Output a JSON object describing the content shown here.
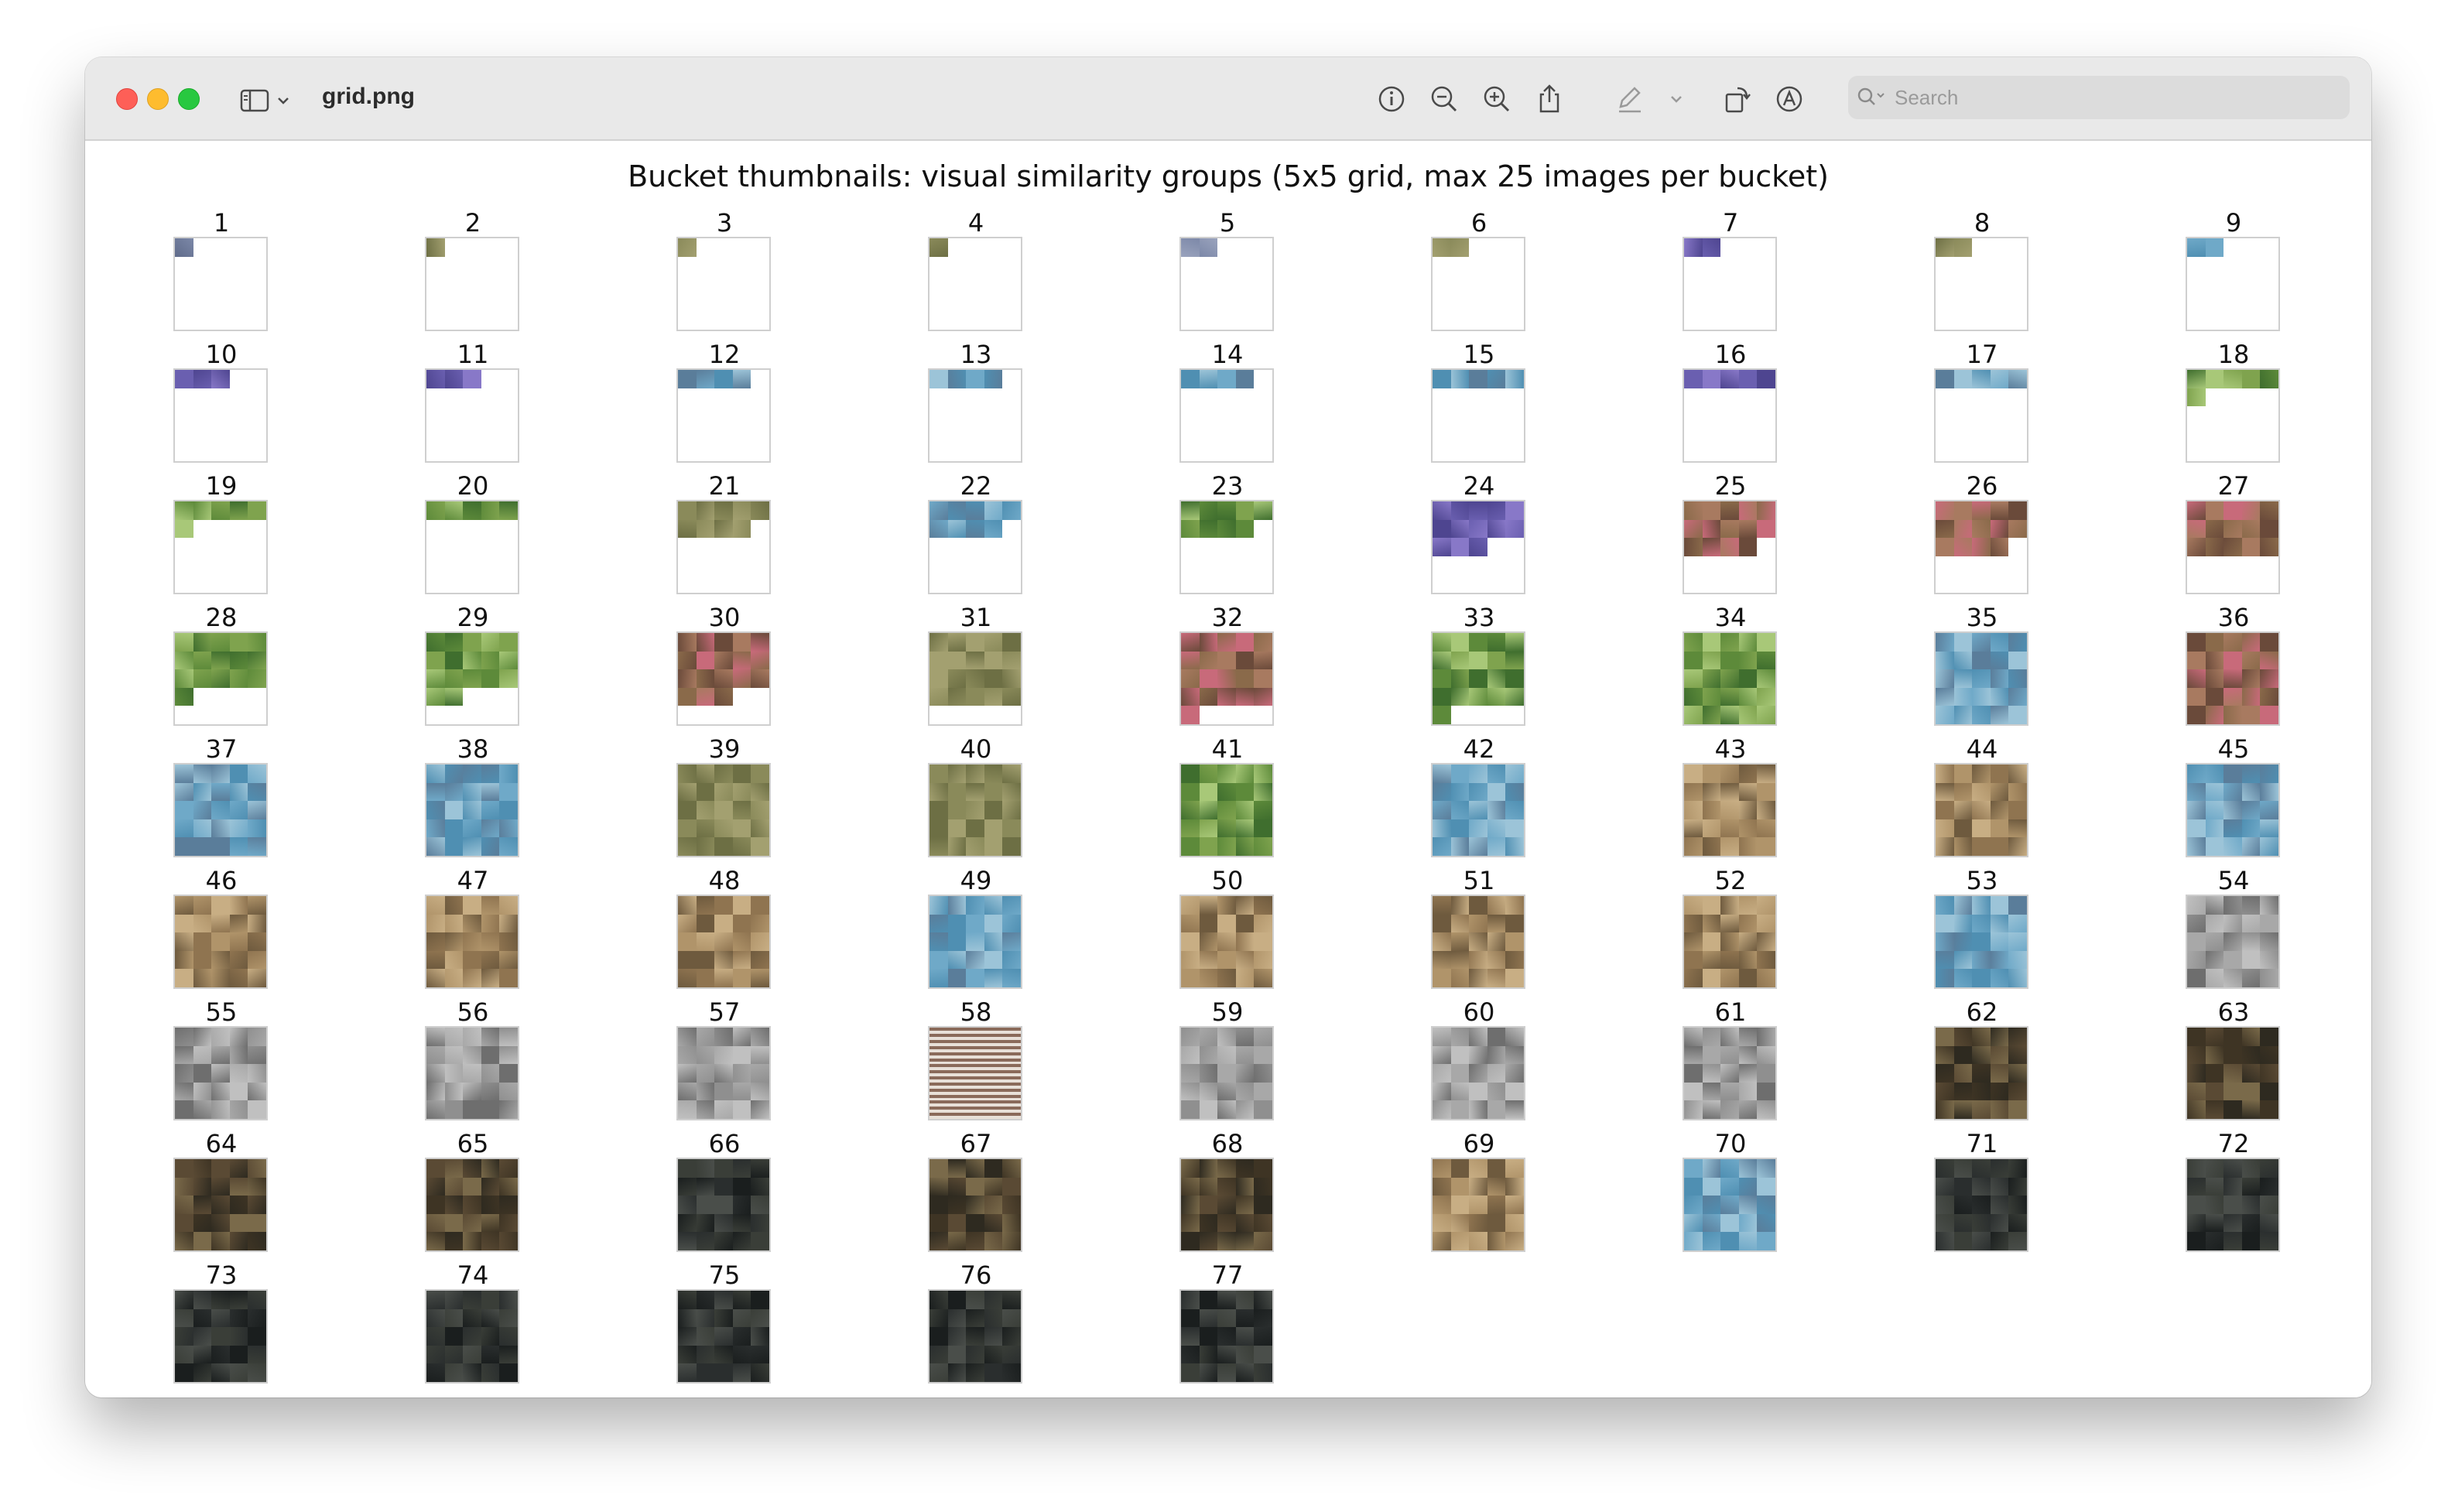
{
  "window": {
    "title": "grid.png"
  },
  "toolbar": {
    "search_placeholder": "Search",
    "icons": [
      "info-icon",
      "zoom-out-icon",
      "zoom-in-icon",
      "share-icon",
      "markup-pen-icon",
      "chevron-down-icon",
      "rotate-icon",
      "annotate-icon"
    ]
  },
  "figure": {
    "title": "Bucket thumbnails: visual similarity groups (5x5 grid, max 25 images per bucket)",
    "buckets": [
      {
        "label": "1",
        "fill": 1,
        "palette": "slate"
      },
      {
        "label": "2",
        "fill": 1,
        "palette": "olive"
      },
      {
        "label": "3",
        "fill": 1,
        "palette": "olive"
      },
      {
        "label": "4",
        "fill": 1,
        "palette": "olive"
      },
      {
        "label": "5",
        "fill": 2,
        "palette": "slate"
      },
      {
        "label": "6",
        "fill": 2,
        "palette": "olive"
      },
      {
        "label": "7",
        "fill": 2,
        "palette": "purple"
      },
      {
        "label": "8",
        "fill": 2,
        "palette": "olive"
      },
      {
        "label": "9",
        "fill": 2,
        "palette": "sky"
      },
      {
        "label": "10",
        "fill": 3,
        "palette": "purple"
      },
      {
        "label": "11",
        "fill": 3,
        "palette": "purple"
      },
      {
        "label": "12",
        "fill": 4,
        "palette": "sky"
      },
      {
        "label": "13",
        "fill": 4,
        "palette": "sky"
      },
      {
        "label": "14",
        "fill": 4,
        "palette": "sky"
      },
      {
        "label": "15",
        "fill": 5,
        "palette": "sky"
      },
      {
        "label": "16",
        "fill": 5,
        "palette": "purple"
      },
      {
        "label": "17",
        "fill": 5,
        "palette": "sky"
      },
      {
        "label": "18",
        "fill": 6,
        "palette": "green"
      },
      {
        "label": "19",
        "fill": 6,
        "palette": "green"
      },
      {
        "label": "20",
        "fill": 5,
        "palette": "green"
      },
      {
        "label": "21",
        "fill": 9,
        "palette": "olive"
      },
      {
        "label": "22",
        "fill": 9,
        "palette": "sky"
      },
      {
        "label": "23",
        "fill": 9,
        "palette": "green"
      },
      {
        "label": "24",
        "fill": 13,
        "palette": "purple"
      },
      {
        "label": "25",
        "fill": 14,
        "palette": "pink"
      },
      {
        "label": "26",
        "fill": 14,
        "palette": "pink"
      },
      {
        "label": "27",
        "fill": 15,
        "palette": "pink"
      },
      {
        "label": "28",
        "fill": 16,
        "palette": "green"
      },
      {
        "label": "29",
        "fill": 17,
        "palette": "green"
      },
      {
        "label": "30",
        "fill": 18,
        "palette": "pink"
      },
      {
        "label": "31",
        "fill": 20,
        "palette": "olive"
      },
      {
        "label": "32",
        "fill": 21,
        "palette": "pink"
      },
      {
        "label": "33",
        "fill": 21,
        "palette": "green"
      },
      {
        "label": "34",
        "fill": 25,
        "palette": "green"
      },
      {
        "label": "35",
        "fill": 25,
        "palette": "sky"
      },
      {
        "label": "36",
        "fill": 25,
        "palette": "pink"
      },
      {
        "label": "37",
        "fill": 25,
        "palette": "sky"
      },
      {
        "label": "38",
        "fill": 25,
        "palette": "sky"
      },
      {
        "label": "39",
        "fill": 25,
        "palette": "olive"
      },
      {
        "label": "40",
        "fill": 25,
        "palette": "olive"
      },
      {
        "label": "41",
        "fill": 25,
        "palette": "green"
      },
      {
        "label": "42",
        "fill": 25,
        "palette": "sky"
      },
      {
        "label": "43",
        "fill": 25,
        "palette": "tan"
      },
      {
        "label": "44",
        "fill": 25,
        "palette": "tan"
      },
      {
        "label": "45",
        "fill": 25,
        "palette": "sky"
      },
      {
        "label": "46",
        "fill": 25,
        "palette": "tan"
      },
      {
        "label": "47",
        "fill": 25,
        "palette": "tan"
      },
      {
        "label": "48",
        "fill": 25,
        "palette": "tan"
      },
      {
        "label": "49",
        "fill": 25,
        "palette": "sky"
      },
      {
        "label": "50",
        "fill": 25,
        "palette": "tan"
      },
      {
        "label": "51",
        "fill": 25,
        "palette": "tan"
      },
      {
        "label": "52",
        "fill": 25,
        "palette": "tan"
      },
      {
        "label": "53",
        "fill": 25,
        "palette": "sky"
      },
      {
        "label": "54",
        "fill": 25,
        "palette": "grey"
      },
      {
        "label": "55",
        "fill": 25,
        "palette": "grey"
      },
      {
        "label": "56",
        "fill": 25,
        "palette": "grey"
      },
      {
        "label": "57",
        "fill": 25,
        "palette": "grey"
      },
      {
        "label": "58",
        "fill": 25,
        "palette": "stripe"
      },
      {
        "label": "59",
        "fill": 25,
        "palette": "grey"
      },
      {
        "label": "60",
        "fill": 25,
        "palette": "grey"
      },
      {
        "label": "61",
        "fill": 25,
        "palette": "grey"
      },
      {
        "label": "62",
        "fill": 25,
        "palette": "dark"
      },
      {
        "label": "63",
        "fill": 25,
        "palette": "dark"
      },
      {
        "label": "64",
        "fill": 25,
        "palette": "dark"
      },
      {
        "label": "65",
        "fill": 25,
        "palette": "dark"
      },
      {
        "label": "66",
        "fill": 25,
        "palette": "night"
      },
      {
        "label": "67",
        "fill": 25,
        "palette": "dark"
      },
      {
        "label": "68",
        "fill": 25,
        "palette": "dark"
      },
      {
        "label": "69",
        "fill": 25,
        "palette": "tan"
      },
      {
        "label": "70",
        "fill": 25,
        "palette": "sky"
      },
      {
        "label": "71",
        "fill": 25,
        "palette": "night"
      },
      {
        "label": "72",
        "fill": 25,
        "palette": "night"
      },
      {
        "label": "73",
        "fill": 25,
        "palette": "night"
      },
      {
        "label": "74",
        "fill": 25,
        "palette": "night"
      },
      {
        "label": "75",
        "fill": 25,
        "palette": "night"
      },
      {
        "label": "76",
        "fill": 25,
        "palette": "night"
      },
      {
        "label": "77",
        "fill": 25,
        "palette": "night"
      }
    ]
  },
  "colors": {
    "close": "#fe5f57",
    "minimize": "#febc2e",
    "maximize": "#28c840",
    "palettes": {
      "slate": [
        "#7c88a8",
        "#5f6b8a",
        "#9aa3bd"
      ],
      "olive": [
        "#8a8a5a",
        "#6d6f44",
        "#a3a070"
      ],
      "purple": [
        "#6a5fb0",
        "#8878c8",
        "#4e4590"
      ],
      "sky": [
        "#6fa9c8",
        "#4f8fb2",
        "#9cc4d8",
        "#5a7d9a"
      ],
      "green": [
        "#7fa34e",
        "#5d8a3a",
        "#a8c878",
        "#3f6e2e"
      ],
      "pink": [
        "#a87a60",
        "#c86a7a",
        "#8a6a4a",
        "#6a4a3a"
      ],
      "tan": [
        "#b0946a",
        "#8f7450",
        "#c8ae84",
        "#6e5a3e"
      ],
      "grey": [
        "#8f8f8f",
        "#a8a8a8",
        "#6e6e6e",
        "#c0c0c0"
      ],
      "stripe": [
        "#8a6a5a",
        "#e8e0d8",
        "#6a4a3a",
        "#c8b8a8"
      ],
      "dark": [
        "#5a4a34",
        "#3e3424",
        "#7a6a4a",
        "#2e2a20"
      ],
      "night": [
        "#2a2e2e",
        "#1a1e1e",
        "#4a4e4a",
        "#3a3e38"
      ]
    }
  }
}
